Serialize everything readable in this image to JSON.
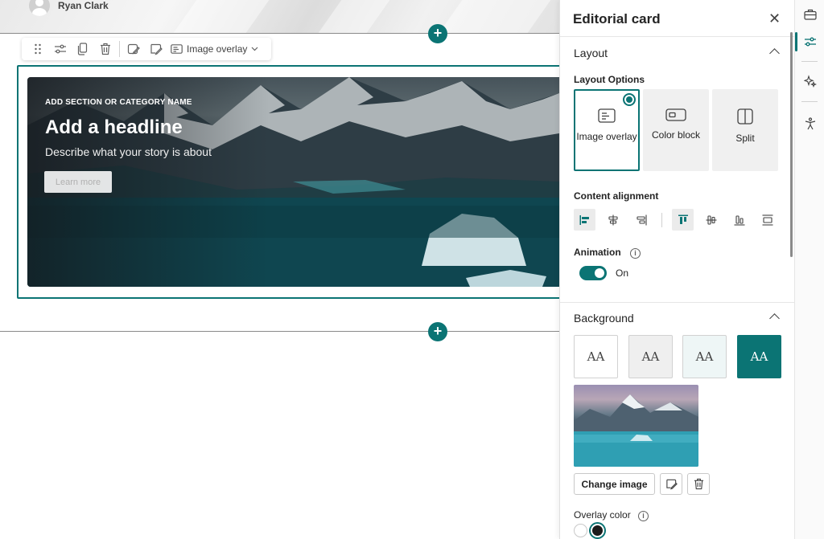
{
  "page": {
    "author_name": "Ryan Clark"
  },
  "toolbar": {
    "layout_dropdown_label": "Image overlay"
  },
  "card": {
    "kicker": "ADD SECTION OR CATEGORY NAME",
    "headline": "Add a headline",
    "description": "Describe what your story is about",
    "button_label": "Learn more"
  },
  "pane": {
    "title": "Editorial card",
    "layout_section": "Layout",
    "layout_options_label": "Layout Options",
    "layout_options": [
      {
        "label": "Image overlay",
        "selected": true
      },
      {
        "label": "Color block",
        "selected": false
      },
      {
        "label": "Split",
        "selected": false
      }
    ],
    "content_alignment_label": "Content alignment",
    "animation_label": "Animation",
    "animation_state": "On",
    "background_section": "Background",
    "background_glyph": "AA",
    "change_image_label": "Change image",
    "overlay_color_label": "Overlay color"
  },
  "colors": {
    "accent": "#0b7474",
    "bg_option_1": "#ffffff",
    "bg_option_2": "#f0f0f0",
    "bg_option_3": "#eef6f6",
    "bg_option_4": "#0b7474"
  },
  "icons": {
    "add": "+",
    "close": "✕"
  }
}
